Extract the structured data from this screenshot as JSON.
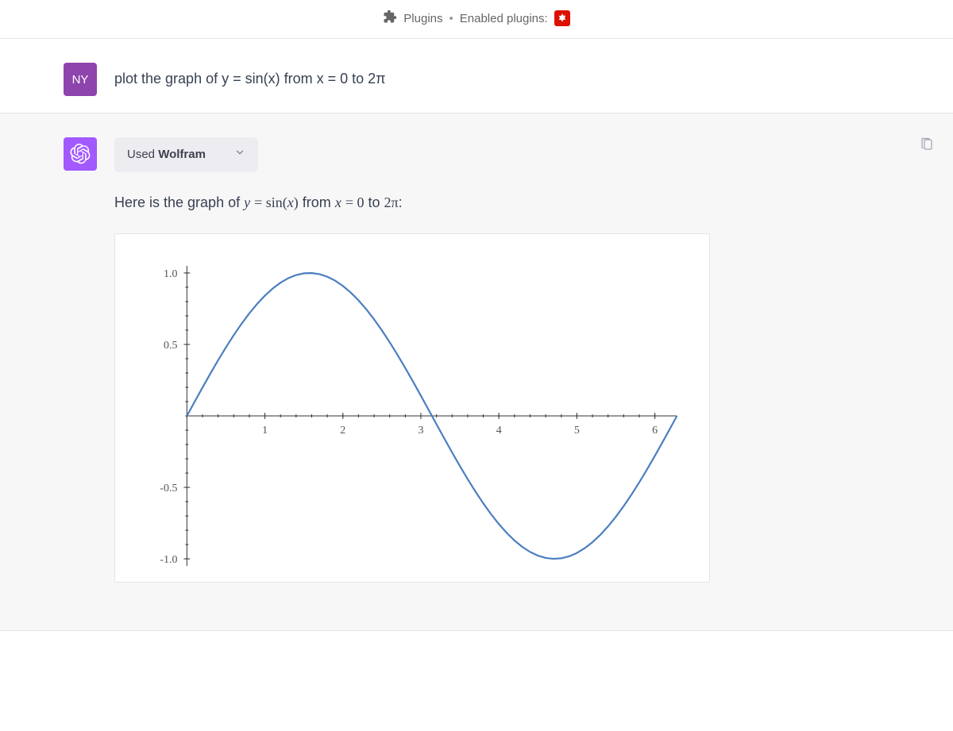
{
  "header": {
    "plugins_label": "Plugins",
    "enabled_label": "Enabled plugins:"
  },
  "user": {
    "avatar_initials": "NY",
    "message": "plot the graph of y = sin(x) from x = 0 to 2π"
  },
  "assistant": {
    "used_plugin_prefix": "Used ",
    "used_plugin_name": "Wolfram",
    "reply_prefix": "Here is the graph of ",
    "reply_mid": " from ",
    "reply_suffix": ":",
    "eq_lhs": "y",
    "eq_rhs_fn": "sin",
    "eq_rhs_arg": "x",
    "eq_rng_var": "x",
    "eq_rng_lo": "0",
    "eq_rng_hi": "2π",
    "eq_rng_to": " to "
  },
  "chart_data": {
    "type": "line",
    "title": "",
    "xlabel": "",
    "ylabel": "",
    "xlim": [
      0,
      6.2832
    ],
    "ylim": [
      -1.05,
      1.05
    ],
    "xticks": [
      1,
      2,
      3,
      4,
      5,
      6
    ],
    "yticks": [
      -1.0,
      -0.5,
      0.5,
      1.0
    ],
    "xtick_labels": [
      "1",
      "2",
      "3",
      "4",
      "5",
      "6"
    ],
    "ytick_labels": [
      "-1.0",
      "-0.5",
      "0.5",
      "1.0"
    ],
    "series": [
      {
        "name": "sin(x)",
        "function": "sin",
        "x": [
          0,
          0.1,
          0.2,
          0.3,
          0.4,
          0.5,
          0.6,
          0.7,
          0.8,
          0.9,
          1.0,
          1.1,
          1.2,
          1.3,
          1.4,
          1.5,
          1.6,
          1.7,
          1.8,
          1.9,
          2.0,
          2.1,
          2.2,
          2.3,
          2.4,
          2.5,
          2.6,
          2.7,
          2.8,
          2.9,
          3.0,
          3.1,
          3.2,
          3.3,
          3.4,
          3.5,
          3.6,
          3.7,
          3.8,
          3.9,
          4.0,
          4.1,
          4.2,
          4.3,
          4.4,
          4.5,
          4.6,
          4.7,
          4.8,
          4.9,
          5.0,
          5.1,
          5.2,
          5.3,
          5.4,
          5.5,
          5.6,
          5.7,
          5.8,
          5.9,
          6.0,
          6.1,
          6.2,
          6.2832
        ],
        "values": [
          0,
          0.0998,
          0.1987,
          0.2955,
          0.3894,
          0.4794,
          0.5646,
          0.6442,
          0.7174,
          0.7833,
          0.8415,
          0.8912,
          0.932,
          0.9636,
          0.9854,
          0.9975,
          0.9996,
          0.9917,
          0.9738,
          0.9463,
          0.9093,
          0.8632,
          0.8085,
          0.7457,
          0.6755,
          0.5985,
          0.5155,
          0.4274,
          0.335,
          0.2392,
          0.1411,
          0.0416,
          -0.0584,
          -0.1577,
          -0.2555,
          -0.3508,
          -0.4425,
          -0.5298,
          -0.6119,
          -0.6878,
          -0.7568,
          -0.8183,
          -0.8716,
          -0.9162,
          -0.9516,
          -0.9775,
          -0.9937,
          -0.9999,
          -0.9962,
          -0.9825,
          -0.9589,
          -0.9258,
          -0.8835,
          -0.8323,
          -0.7728,
          -0.7055,
          -0.6313,
          -0.5507,
          -0.4646,
          -0.3739,
          -0.2794,
          -0.1822,
          -0.0831,
          0.0
        ]
      }
    ]
  }
}
